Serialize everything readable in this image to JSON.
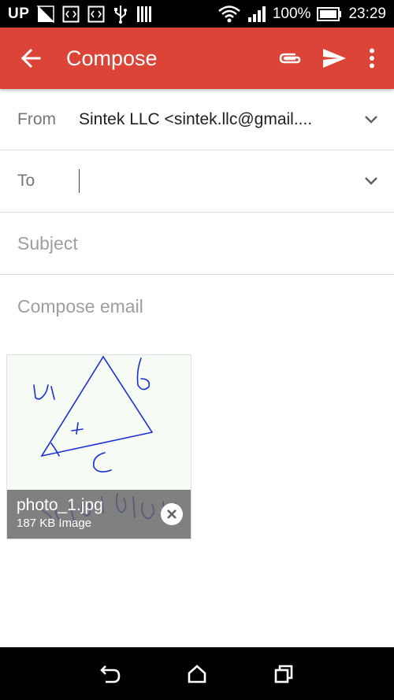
{
  "status_bar": {
    "carrier_badge": "UP",
    "battery_percent": "100%",
    "time": "23:29",
    "icons": [
      "signal-triangle-icon",
      "code-icon",
      "code-icon",
      "usb-icon",
      "barcode-icon",
      "wifi-icon",
      "cell-signal-icon",
      "battery-icon"
    ]
  },
  "app_bar": {
    "title": "Compose",
    "icons": [
      "back-arrow-icon",
      "attach-icon",
      "send-icon",
      "more-vert-icon"
    ],
    "color": "#db4437"
  },
  "from": {
    "label": "From",
    "value": "Sintek LLC  <sintek.llc@gmail...."
  },
  "to": {
    "label": "To",
    "value": ""
  },
  "subject": {
    "placeholder": "Subject"
  },
  "body": {
    "placeholder": "Compose email"
  },
  "attachment": {
    "filename": "photo_1.jpg",
    "details": "187 KB Image"
  },
  "nav_bar": {
    "icons": [
      "back-nav-icon",
      "home-icon",
      "recents-icon"
    ]
  }
}
